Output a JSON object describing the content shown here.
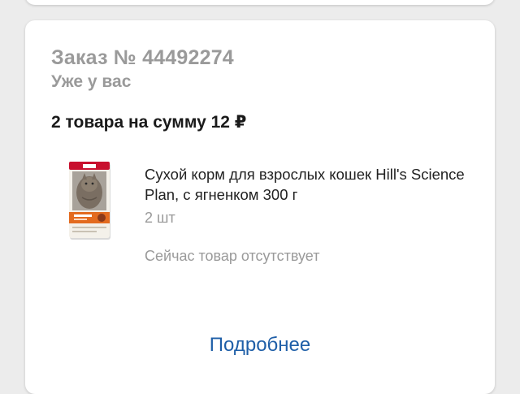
{
  "order": {
    "title": "Заказ № 44492274",
    "status": "Уже у вас",
    "summary": "2 товара на сумму 12 ₽"
  },
  "product": {
    "name": "Сухой корм для взрослых кошек Hill's Science Plan, с ягненком 300 г",
    "quantity": "2 шт",
    "availability": "Сейчас товар отсутствует",
    "image_brand": "Hill's"
  },
  "actions": {
    "details_label": "Подробнее"
  },
  "colors": {
    "accent_link": "#1f5fa8",
    "muted_text": "#9a9a9a"
  }
}
